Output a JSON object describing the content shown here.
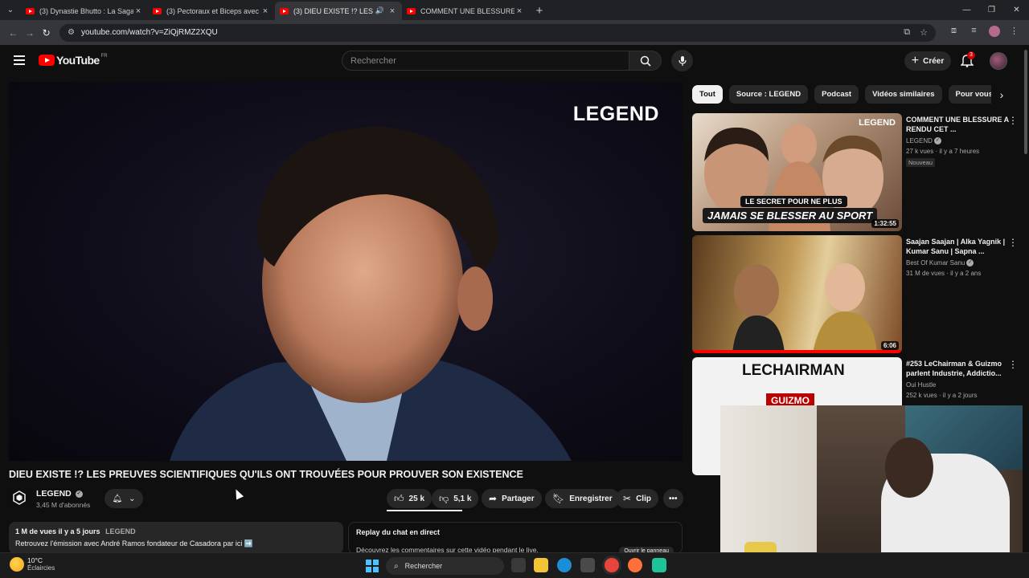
{
  "browser": {
    "tabs": [
      {
        "title": "(3) Dynastie Bhutto : La Saga Sa",
        "active": false
      },
      {
        "title": "(3) Pectoraux et Biceps avec Tib",
        "active": false
      },
      {
        "title": "(3) DIEU EXISTE !? LES PREU",
        "active": true
      },
      {
        "title": "COMMENT UNE BLESSURE A R",
        "active": false
      }
    ],
    "url": "youtube.com/watch?v=ZiQjRMZ2XQU"
  },
  "youtube": {
    "logo_text": "YouTube",
    "country_code": "FR",
    "search_placeholder": "Rechercher",
    "create_label": "Créer",
    "notification_count": "3"
  },
  "video": {
    "watermark": "LEGEND",
    "title": "DIEU EXISTE !? LES PREUVES SCIENTIFIQUES QU'ILS ONT TROUVÉES POUR PROUVER SON EXISTENCE",
    "channel": "LEGEND",
    "subscribers": "3,45 M d'abonnés",
    "likes": "25 k",
    "dislikes": "5,1 k",
    "share_label": "Partager",
    "save_label": "Enregistrer",
    "clip_label": "Clip",
    "description_meta": "1 M de vues  il y a 5 jours",
    "description_channel": "LEGEND",
    "description_line": "Retrouvez l'émission avec André Ramos fondateur de Casadora par ici ➡️"
  },
  "replay": {
    "title": "Replay du chat en direct",
    "text": "Découvrez les commentaires sur cette vidéo pendant le live.",
    "open_label": "Ouvrir le panneau"
  },
  "chips": [
    "Tout",
    "Source : LEGEND",
    "Podcast",
    "Vidéos similaires",
    "Pour vous",
    "Pu"
  ],
  "recommendations": [
    {
      "title": "COMMENT UNE BLESSURE A RENDU CET ...",
      "channel": "LEGEND",
      "stats": "27 k vues · il y a 7 heures",
      "badge": "Nouveau",
      "duration": "1:32:55",
      "thumb_brand": "LEGEND",
      "thumb_caption1": "LE SECRET POUR NE PLUS",
      "thumb_caption2": "JAMAIS SE BLESSER AU SPORT"
    },
    {
      "title": "Saajan Saajan | Alka Yagnik | Kumar Sanu | Sapna ...",
      "channel": "Best Of Kumar Sanu",
      "stats": "31 M de vues · il y a 2 ans",
      "duration": "6:06"
    },
    {
      "title": "#253 LeChairman & Guizmo parlent Industrie, Addictio...",
      "channel": "Oui Hustle",
      "stats": "252 k vues · il y a 2 jours",
      "thumb_text1": "LECHAIRMAN",
      "thumb_text2": "GUIZMO"
    }
  ],
  "taskbar": {
    "temperature": "10°C",
    "condition": "Éclaircies",
    "search_label": "Rechercher"
  },
  "colors": {
    "youtube_red": "#ff0000",
    "background": "#0f0f0f",
    "chip_bg": "#272727",
    "windows_accent": "#4cc2ff"
  }
}
